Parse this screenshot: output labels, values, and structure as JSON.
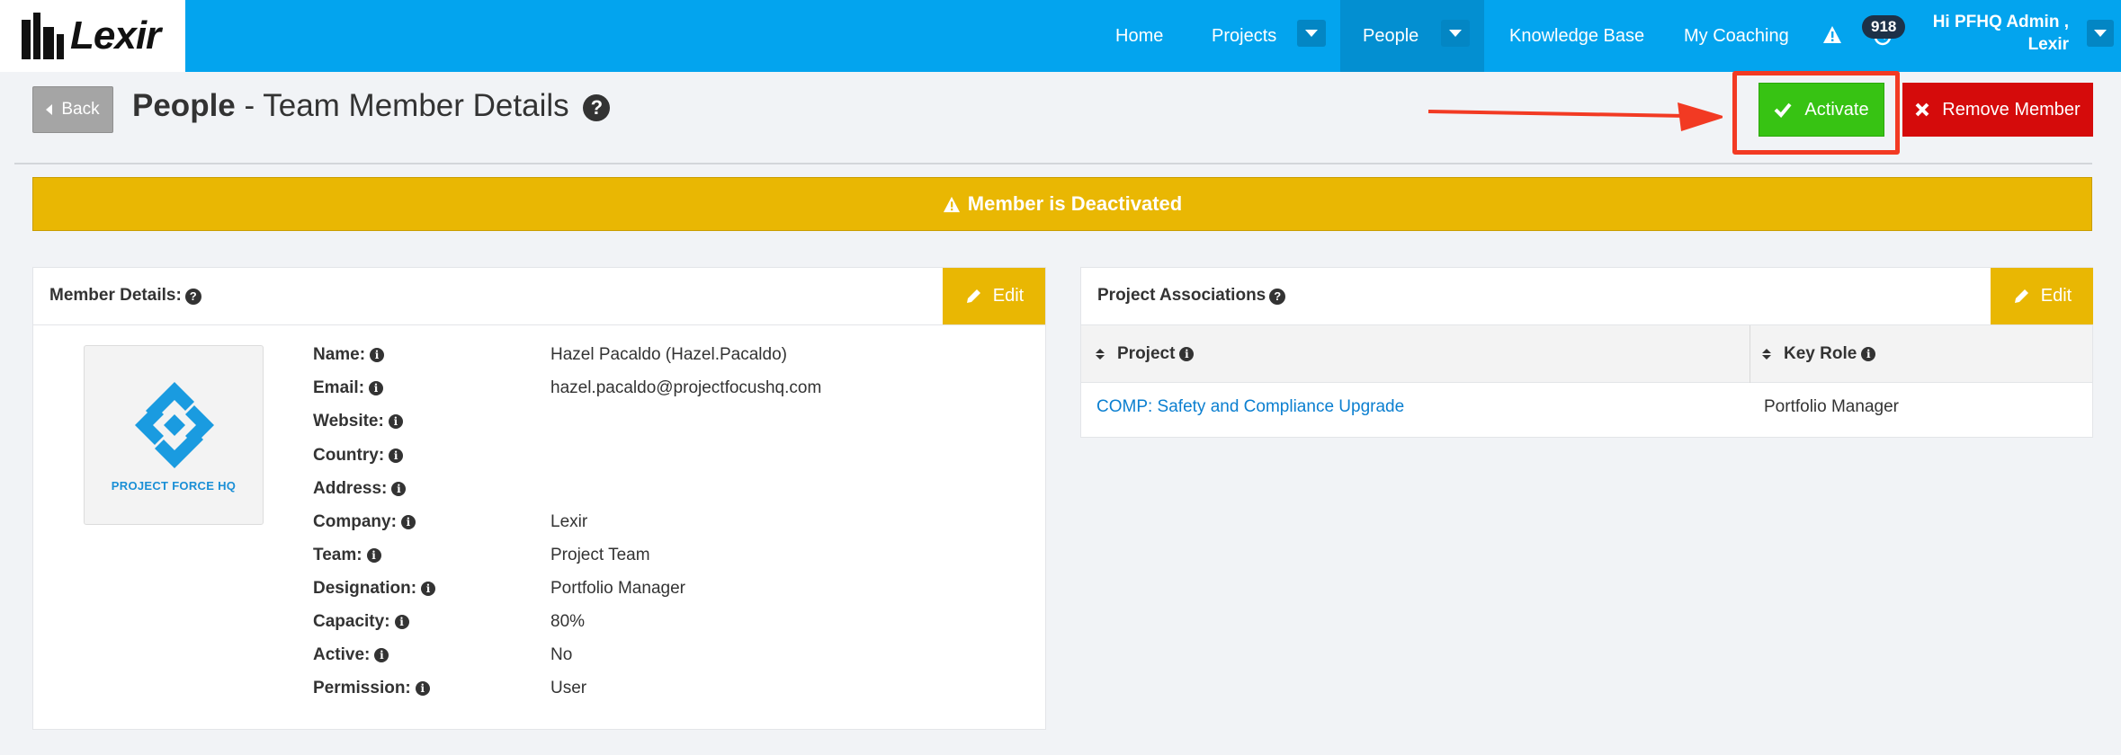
{
  "brand": {
    "logo_text": "Lexir"
  },
  "nav": {
    "items": [
      {
        "label": "Home"
      },
      {
        "label": "Projects"
      },
      {
        "label": "People"
      },
      {
        "label": "Knowledge Base"
      },
      {
        "label": "My Coaching"
      }
    ],
    "notification_count": "918",
    "user_greeting_line1": "Hi PFHQ Admin ,",
    "user_greeting_line2": "Lexir"
  },
  "header": {
    "back_label": "Back",
    "title_bold": "People",
    "title_rest": " - Team Member Details",
    "activate_label": "Activate",
    "remove_label": "Remove Member"
  },
  "banner": {
    "text": "Member is Deactivated"
  },
  "member_panel": {
    "title": "Member Details:",
    "edit_label": "Edit",
    "avatar_caption": "PROJECT FORCE HQ",
    "fields": [
      {
        "label": "Name:",
        "value": "Hazel Pacaldo (Hazel.Pacaldo)"
      },
      {
        "label": "Email:",
        "value": "hazel.pacaldo@projectfocushq.com"
      },
      {
        "label": "Website:",
        "value": ""
      },
      {
        "label": "Country:",
        "value": ""
      },
      {
        "label": "Address:",
        "value": ""
      },
      {
        "label": "Company:",
        "value": "Lexir"
      },
      {
        "label": "Team:",
        "value": "Project Team"
      },
      {
        "label": "Designation:",
        "value": "Portfolio Manager"
      },
      {
        "label": "Capacity:",
        "value": "80%"
      },
      {
        "label": "Active:",
        "value": "No"
      },
      {
        "label": "Permission:",
        "value": "User"
      }
    ]
  },
  "projects_panel": {
    "title": "Project Associations",
    "edit_label": "Edit",
    "columns": [
      "Project",
      "Key Role"
    ],
    "rows": [
      {
        "project": "COMP: Safety and Compliance Upgrade",
        "role": "Portfolio Manager"
      }
    ]
  },
  "colors": {
    "nav_blue": "#03a4ee",
    "activate_green": "#37c313",
    "remove_red": "#d50b0b",
    "warning_yellow": "#e9b703",
    "annotation_red": "#f23a23",
    "link_blue": "#0b7fd0"
  }
}
